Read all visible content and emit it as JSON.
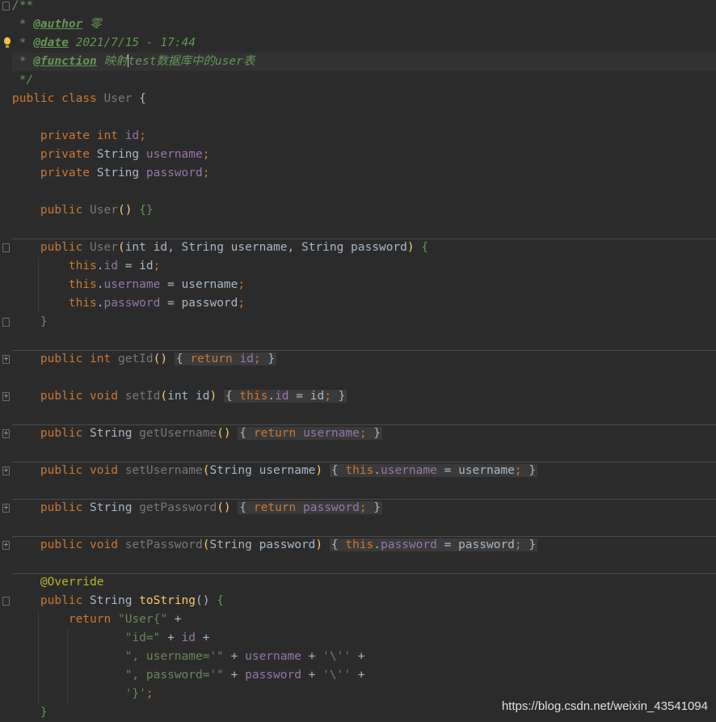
{
  "editor": {
    "javadoc": {
      "open": "/**",
      "author_tag": "@author",
      "author_value": "零",
      "date_tag": "@date",
      "date_value": "2021/7/15 - 17:44",
      "function_tag": "@function",
      "function_value_a": "映射",
      "function_value_b": "test数据库中的user表",
      "close": "*/"
    },
    "class_decl": {
      "kw1": "public",
      "kw2": "class",
      "name": "User",
      "brace": "{"
    },
    "fields": [
      {
        "mod": "private",
        "type": "int",
        "name": "id"
      },
      {
        "mod": "private",
        "type": "String",
        "name": "username"
      },
      {
        "mod": "private",
        "type": "String",
        "name": "password"
      }
    ],
    "ctor_empty": {
      "mod": "public",
      "name": "User",
      "parens": "()",
      "body": "{}"
    },
    "ctor_full": {
      "mod": "public",
      "name": "User",
      "params": "int id, String username, String password",
      "assign": [
        {
          "this": "this",
          "field": "id",
          "rhs": "id"
        },
        {
          "this": "this",
          "field": "username",
          "rhs": "username"
        },
        {
          "this": "this",
          "field": "password",
          "rhs": "password"
        }
      ]
    },
    "methods": [
      {
        "mod": "public",
        "type": "int",
        "name": "getId",
        "params": "",
        "body_kw": "return",
        "body_field": "id",
        "body_rhs": ""
      },
      {
        "mod": "public",
        "type": "void",
        "name": "setId",
        "params": "int id",
        "body_kw": "this",
        "body_field": "id",
        "body_rhs": "id"
      },
      {
        "mod": "public",
        "type": "String",
        "name": "getUsername",
        "params": "",
        "body_kw": "return",
        "body_field": "username",
        "body_rhs": ""
      },
      {
        "mod": "public",
        "type": "void",
        "name": "setUsername",
        "params": "String username",
        "body_kw": "this",
        "body_field": "username",
        "body_rhs": "username"
      },
      {
        "mod": "public",
        "type": "String",
        "name": "getPassword",
        "params": "",
        "body_kw": "return",
        "body_field": "password",
        "body_rhs": ""
      },
      {
        "mod": "public",
        "type": "void",
        "name": "setPassword",
        "params": "String password",
        "body_kw": "this",
        "body_field": "password",
        "body_rhs": "password"
      }
    ],
    "to_string": {
      "annotation": "@Override",
      "mod": "public",
      "type": "String",
      "name": "toString",
      "ret": "return",
      "s1": "\"User{\"",
      "s2": "\"id=\"",
      "f_id": "id",
      "s3": "\", username='\"",
      "f_user": "username",
      "q": "'\\''",
      "s4": "\", password='\"",
      "f_pass": "password",
      "s5": "'}'"
    }
  },
  "watermark": "https://blog.csdn.net/weixin_43541094"
}
